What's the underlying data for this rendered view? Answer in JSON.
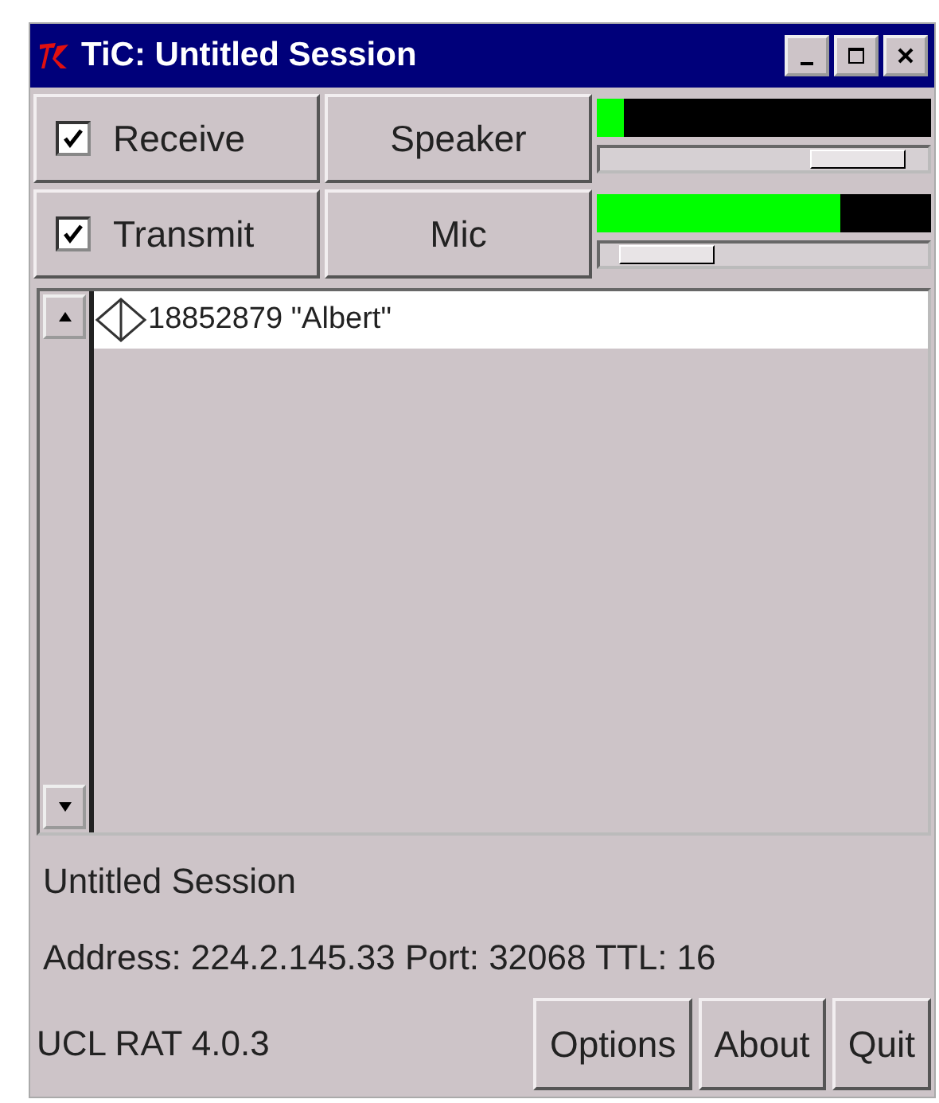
{
  "window": {
    "title": "TiC: Untitled Session"
  },
  "channels": [
    {
      "label": "Receive",
      "checked": true,
      "device": "Speaker",
      "meter": {
        "level": 0.08
      },
      "slider": {
        "level": 0.92
      }
    },
    {
      "label": "Transmit",
      "checked": true,
      "device": "Mic",
      "meter": {
        "level": 0.73
      },
      "slider": {
        "level": 0.08
      }
    }
  ],
  "participants": [
    {
      "label": "18852879 \"Albert\""
    }
  ],
  "session_name": "Untitled Session",
  "address": "Address: 224.2.145.33 Port: 32068 TTL: 16",
  "version": "UCL RAT 4.0.3",
  "buttons": [
    "Options",
    "About",
    "Quit"
  ]
}
